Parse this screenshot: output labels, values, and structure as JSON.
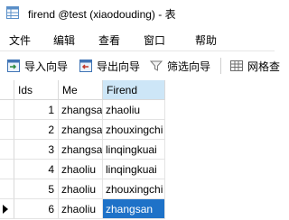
{
  "window": {
    "title": "firend @test (xiaodouding) - 表"
  },
  "menu": [
    "文件",
    "编辑",
    "查看",
    "窗口",
    "帮助"
  ],
  "toolbar": {
    "import_label": "导入向导",
    "export_label": "导出向导",
    "filter_label": "筛选向导",
    "grid_label": "网格查"
  },
  "table": {
    "columns": [
      "Ids",
      "Me",
      "Firend"
    ],
    "rows": [
      {
        "ids": "1",
        "me": "zhangsan",
        "firend": "zhaoliu"
      },
      {
        "ids": "2",
        "me": "zhangsan",
        "firend": "zhouxingchi"
      },
      {
        "ids": "3",
        "me": "zhangsan",
        "firend": "linqingkuai"
      },
      {
        "ids": "4",
        "me": "zhaoliu",
        "firend": "linqingkuai"
      },
      {
        "ids": "5",
        "me": "zhaoliu",
        "firend": "zhouxingchi"
      },
      {
        "ids": "6",
        "me": "zhaoliu",
        "firend": "zhangsan"
      }
    ],
    "current_row": 6,
    "selected_column": "Firend"
  },
  "colors": {
    "selection": "#1e72c8",
    "header_selected": "#cde6f7"
  },
  "icons": [
    "table-icon",
    "import-icon",
    "export-icon",
    "filter-icon",
    "grid-icon"
  ]
}
